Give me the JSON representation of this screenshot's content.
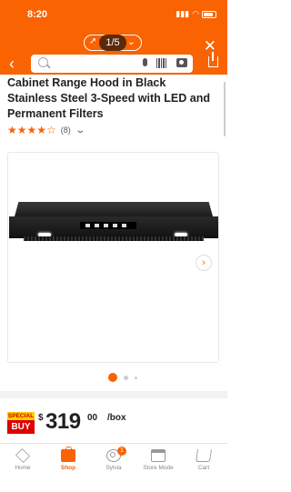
{
  "status_bar": {
    "time": "8:20"
  },
  "header": {
    "pager_count": "1/5",
    "search_placeholder": ""
  },
  "product": {
    "title": "Cabinet Range Hood in Black Stainless Steel 3-Speed with LED and Permanent Filters",
    "rating_stars": "★★★★☆",
    "review_count": "(8)"
  },
  "gallery": {
    "next_glyph": "›",
    "total_images": 3
  },
  "price": {
    "special_top": "SPECIAL",
    "special_bottom": "BUY",
    "currency": "$",
    "dollars": "319",
    "cents": "00",
    "unit": "/box"
  },
  "tabbar": {
    "items": [
      {
        "label": "Home"
      },
      {
        "label": "Shop"
      },
      {
        "label": "Sylvia",
        "badge": "1"
      },
      {
        "label": "Store Mode"
      },
      {
        "label": "Cart"
      }
    ]
  },
  "colors": {
    "accent": "#f96302",
    "special_red": "#dd0000",
    "special_yellow": "#ffcc00"
  }
}
